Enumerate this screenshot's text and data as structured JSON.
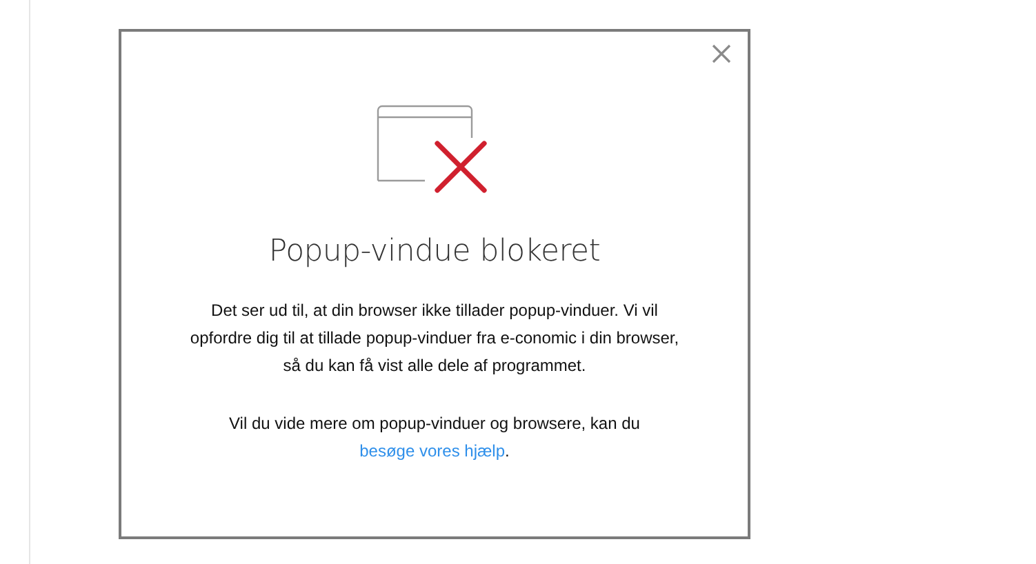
{
  "dialog": {
    "title": "Popup-vindue blokeret",
    "message": "Det ser ud til, at din browser ikke tillader popup-vinduer. Vi vil opfordre dig til at tillade popup-vinduer fra e-conomic i din browser, så du kan få vist alle dele af programmet.",
    "help": {
      "text": "Vil du vide mere om popup-vinduer og browsere, kan du",
      "link": "besøge vores hjælp",
      "after": "."
    }
  }
}
